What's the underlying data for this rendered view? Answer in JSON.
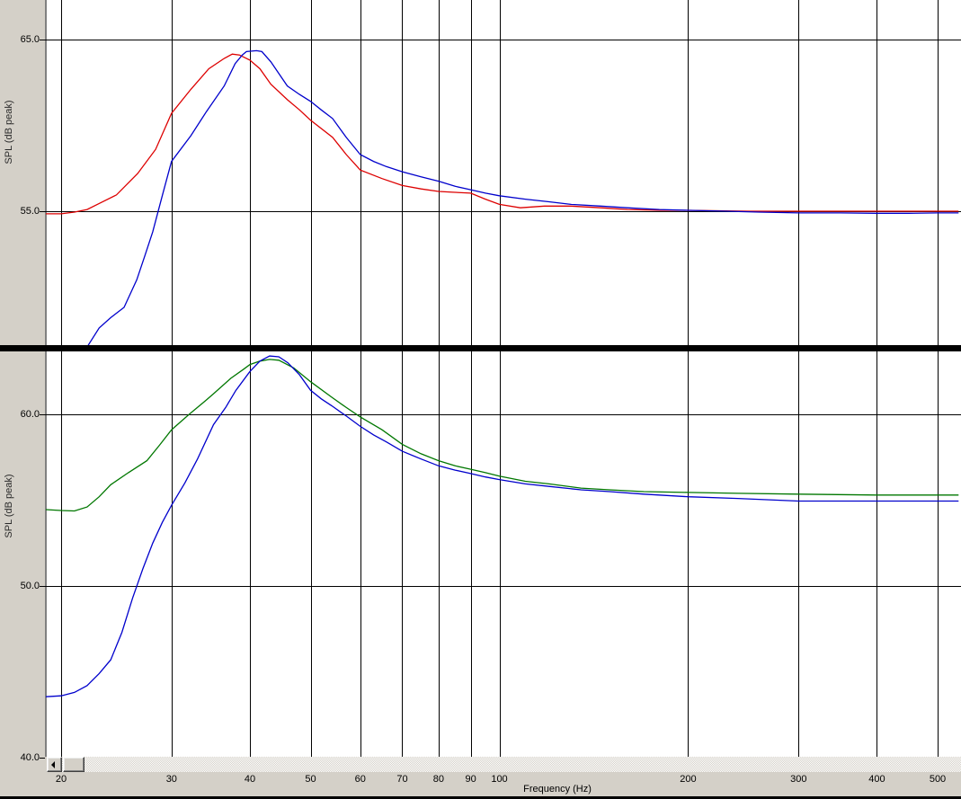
{
  "window": {
    "bg_color": "#d4d0c8",
    "plot_bg_color": "#ffffff",
    "grid_color": "#000000",
    "divider_color": "#000000"
  },
  "x_axis": {
    "label": "Frequency (Hz)",
    "scale": "log",
    "range_hz": [
      18.9,
      540
    ],
    "ticks": [
      {
        "f": 20,
        "label": "20"
      },
      {
        "f": 30,
        "label": "30"
      },
      {
        "f": 40,
        "label": "40"
      },
      {
        "f": 50,
        "label": "50"
      },
      {
        "f": 60,
        "label": "60"
      },
      {
        "f": 70,
        "label": "70"
      },
      {
        "f": 80,
        "label": "80"
      },
      {
        "f": 90,
        "label": "90"
      },
      {
        "f": 100,
        "label": "100"
      },
      {
        "f": 200,
        "label": "200"
      },
      {
        "f": 300,
        "label": "300"
      },
      {
        "f": 400,
        "label": "400"
      },
      {
        "f": 500,
        "label": "500"
      }
    ]
  },
  "scrollbar": {
    "left_arrow_icon": "scroll-left-arrow-icon",
    "orientation": "horizontal"
  },
  "chart_data": [
    {
      "type": "line",
      "position": "top",
      "ylabel": "SPL (dB peak)",
      "xlabel": "Frequency (Hz)",
      "grid": true,
      "x_scale": "log",
      "xlim": [
        18.9,
        540
      ],
      "ylim_visible": [
        47.2,
        67.3
      ],
      "y_ticks": [
        {
          "v": 65,
          "label": "65.0"
        },
        {
          "v": 55,
          "label": "55.0"
        }
      ],
      "series": [
        {
          "name": "red-response",
          "color": "#dd0000",
          "points": [
            [
              18.9,
              54.85
            ],
            [
              20,
              54.85
            ],
            [
              21,
              54.95
            ],
            [
              22,
              55.1
            ],
            [
              23,
              55.45
            ],
            [
              24.5,
              55.95
            ],
            [
              26.5,
              57.2
            ],
            [
              28.3,
              58.6
            ],
            [
              30,
              60.7
            ],
            [
              32.2,
              62.1
            ],
            [
              34.4,
              63.3
            ],
            [
              36.4,
              63.9
            ],
            [
              37.5,
              64.15
            ],
            [
              38.5,
              64.1
            ],
            [
              40,
              63.8
            ],
            [
              41.5,
              63.3
            ],
            [
              43.2,
              62.4
            ],
            [
              45.9,
              61.5
            ],
            [
              48,
              60.9
            ],
            [
              50,
              60.3
            ],
            [
              54.2,
              59.3
            ],
            [
              57,
              58.3
            ],
            [
              60,
              57.4
            ],
            [
              65,
              56.9
            ],
            [
              70,
              56.5
            ],
            [
              75,
              56.3
            ],
            [
              80,
              56.15
            ],
            [
              85,
              56.1
            ],
            [
              90,
              56.05
            ],
            [
              95,
              55.7
            ],
            [
              100,
              55.4
            ],
            [
              108,
              55.2
            ],
            [
              118,
              55.3
            ],
            [
              130,
              55.3
            ],
            [
              145,
              55.2
            ],
            [
              160,
              55.1
            ],
            [
              180,
              55.05
            ],
            [
              200,
              55.05
            ],
            [
              250,
              55.0
            ],
            [
              300,
              55.0
            ],
            [
              400,
              55.0
            ],
            [
              500,
              55.0
            ],
            [
              540,
              55.0
            ]
          ]
        },
        {
          "name": "blue-response",
          "color": "#0000cc",
          "points": [
            [
              21.5,
              45.8
            ],
            [
              22.1,
              47.2
            ],
            [
              23,
              48.2
            ],
            [
              24,
              48.8
            ],
            [
              25.2,
              49.4
            ],
            [
              26.4,
              51.0
            ],
            [
              27.2,
              52.4
            ],
            [
              28,
              53.8
            ],
            [
              29,
              55.9
            ],
            [
              30,
              57.9
            ],
            [
              32.2,
              59.4
            ],
            [
              34.1,
              60.8
            ],
            [
              36.4,
              62.3
            ],
            [
              37.9,
              63.6
            ],
            [
              38.9,
              64.1
            ],
            [
              39.5,
              64.3
            ],
            [
              41,
              64.35
            ],
            [
              41.8,
              64.3
            ],
            [
              43.2,
              63.7
            ],
            [
              45.9,
              62.3
            ],
            [
              48,
              61.8
            ],
            [
              50,
              61.4
            ],
            [
              52,
              60.9
            ],
            [
              54.2,
              60.4
            ],
            [
              57,
              59.3
            ],
            [
              60,
              58.3
            ],
            [
              63,
              57.9
            ],
            [
              66,
              57.6
            ],
            [
              70,
              57.3
            ],
            [
              75,
              57.0
            ],
            [
              80,
              56.75
            ],
            [
              85,
              56.45
            ],
            [
              90,
              56.25
            ],
            [
              95,
              56.05
            ],
            [
              100,
              55.9
            ],
            [
              110,
              55.7
            ],
            [
              120,
              55.55
            ],
            [
              130,
              55.4
            ],
            [
              145,
              55.3
            ],
            [
              160,
              55.2
            ],
            [
              180,
              55.1
            ],
            [
              200,
              55.05
            ],
            [
              230,
              55.0
            ],
            [
              260,
              54.95
            ],
            [
              300,
              54.9
            ],
            [
              350,
              54.9
            ],
            [
              400,
              54.88
            ],
            [
              450,
              54.88
            ],
            [
              500,
              54.9
            ],
            [
              540,
              54.9
            ]
          ]
        }
      ]
    },
    {
      "type": "line",
      "position": "bottom",
      "ylabel": "SPL (dB peak)",
      "xlabel": "Frequency (Hz)",
      "grid": true,
      "x_scale": "log",
      "xlim": [
        18.9,
        540
      ],
      "ylim_visible": [
        40.1,
        63.7
      ],
      "y_ticks": [
        {
          "v": 60,
          "label": "60.0"
        },
        {
          "v": 50,
          "label": "50.0"
        },
        {
          "v": 40,
          "label": "40.0"
        }
      ],
      "series": [
        {
          "name": "green-response",
          "color": "#007700",
          "points": [
            [
              18.9,
              54.45
            ],
            [
              20,
              54.4
            ],
            [
              21,
              54.37
            ],
            [
              22,
              54.6
            ],
            [
              23,
              55.2
            ],
            [
              24,
              55.9
            ],
            [
              25.6,
              56.6
            ],
            [
              27.4,
              57.3
            ],
            [
              28.7,
              58.2
            ],
            [
              30,
              59.1
            ],
            [
              32,
              60.0
            ],
            [
              34,
              60.8
            ],
            [
              35,
              61.2
            ],
            [
              37.3,
              62.1
            ],
            [
              39,
              62.6
            ],
            [
              40,
              62.9
            ],
            [
              41.5,
              63.1
            ],
            [
              43,
              63.2
            ],
            [
              44.5,
              63.15
            ],
            [
              47,
              62.7
            ],
            [
              50,
              61.9
            ],
            [
              54,
              61.0
            ],
            [
              57,
              60.4
            ],
            [
              60,
              59.85
            ],
            [
              65,
              59.1
            ],
            [
              70,
              58.25
            ],
            [
              75,
              57.7
            ],
            [
              80,
              57.3
            ],
            [
              85,
              57.0
            ],
            [
              90,
              56.8
            ],
            [
              95,
              56.6
            ],
            [
              100,
              56.4
            ],
            [
              110,
              56.1
            ],
            [
              120,
              55.95
            ],
            [
              135,
              55.7
            ],
            [
              150,
              55.6
            ],
            [
              170,
              55.5
            ],
            [
              200,
              55.45
            ],
            [
              240,
              55.4
            ],
            [
              300,
              55.35
            ],
            [
              400,
              55.3
            ],
            [
              500,
              55.3
            ],
            [
              540,
              55.3
            ]
          ]
        },
        {
          "name": "blue-response",
          "color": "#0000cc",
          "points": [
            [
              18.9,
              43.55
            ],
            [
              20,
              43.6
            ],
            [
              21,
              43.8
            ],
            [
              22,
              44.2
            ],
            [
              23,
              44.9
            ],
            [
              24,
              45.7
            ],
            [
              25,
              47.3
            ],
            [
              26,
              49.3
            ],
            [
              27,
              51.0
            ],
            [
              28,
              52.5
            ],
            [
              29,
              53.7
            ],
            [
              30,
              54.7
            ],
            [
              31.5,
              56.0
            ],
            [
              33,
              57.4
            ],
            [
              35,
              59.4
            ],
            [
              36.6,
              60.4
            ],
            [
              38,
              61.4
            ],
            [
              40,
              62.5
            ],
            [
              41.5,
              63.1
            ],
            [
              43,
              63.4
            ],
            [
              44.5,
              63.35
            ],
            [
              46,
              63.0
            ],
            [
              48,
              62.3
            ],
            [
              50,
              61.4
            ],
            [
              52,
              60.9
            ],
            [
              54,
              60.5
            ],
            [
              57,
              59.9
            ],
            [
              60,
              59.3
            ],
            [
              63,
              58.8
            ],
            [
              66,
              58.4
            ],
            [
              70,
              57.85
            ],
            [
              75,
              57.4
            ],
            [
              80,
              57.0
            ],
            [
              85,
              56.75
            ],
            [
              90,
              56.55
            ],
            [
              95,
              56.35
            ],
            [
              100,
              56.2
            ],
            [
              110,
              55.95
            ],
            [
              120,
              55.8
            ],
            [
              135,
              55.6
            ],
            [
              150,
              55.5
            ],
            [
              170,
              55.35
            ],
            [
              200,
              55.2
            ],
            [
              240,
              55.1
            ],
            [
              300,
              54.95
            ],
            [
              400,
              54.95
            ],
            [
              500,
              54.95
            ],
            [
              540,
              54.95
            ]
          ]
        }
      ]
    }
  ]
}
